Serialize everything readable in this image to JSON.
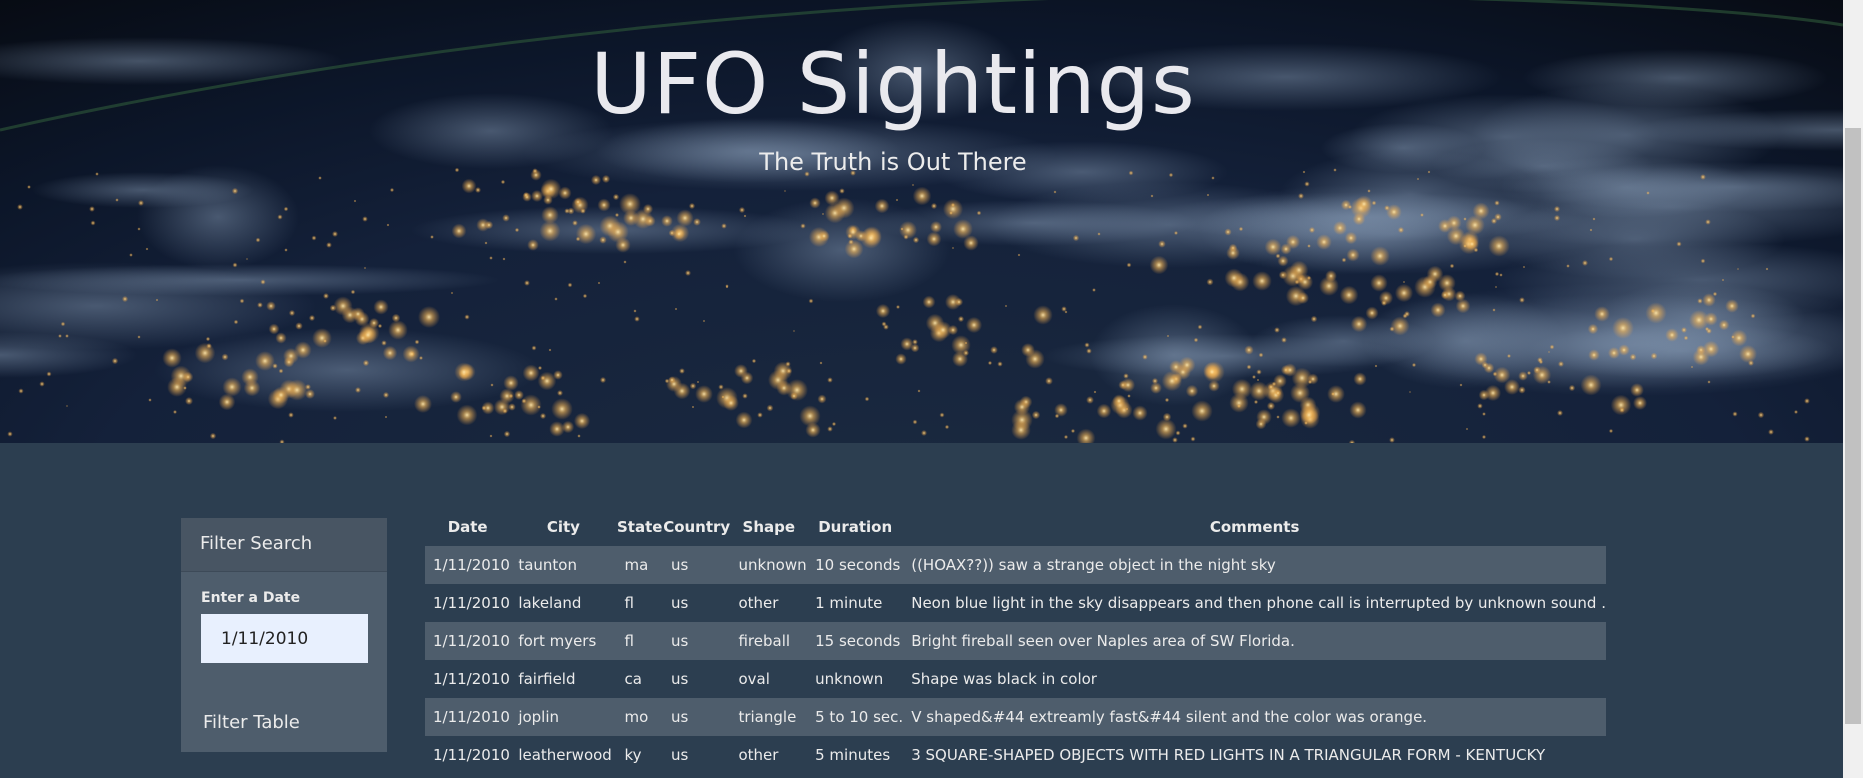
{
  "hero": {
    "title": "UFO Sightings",
    "subtitle": "The Truth is Out There"
  },
  "filter": {
    "header": "Filter Search",
    "date_label": "Enter a Date",
    "date_value": "1/11/2010",
    "button_label": "Filter Table"
  },
  "table": {
    "columns": [
      "Date",
      "City",
      "State",
      "Country",
      "Shape",
      "Duration",
      "Comments"
    ],
    "rows": [
      [
        "1/11/2010",
        "taunton",
        "ma",
        "us",
        "unknown",
        "10 seconds",
        "((HOAX??)) saw a strange object in the night sky"
      ],
      [
        "1/11/2010",
        "lakeland",
        "fl",
        "us",
        "other",
        "1 minute",
        "Neon blue light in the sky disappears and then phone call is interrupted by unknown sound ."
      ],
      [
        "1/11/2010",
        "fort myers",
        "fl",
        "us",
        "fireball",
        "15 seconds",
        "Bright fireball seen over Naples area of SW Florida."
      ],
      [
        "1/11/2010",
        "fairfield",
        "ca",
        "us",
        "oval",
        "unknown",
        "Shape was black in color"
      ],
      [
        "1/11/2010",
        "joplin",
        "mo",
        "us",
        "triangle",
        "5 to 10 sec.",
        "V shaped&#44 extreamly fast&#44 silent and the color was orange."
      ],
      [
        "1/11/2010",
        "leatherwood",
        "ky",
        "us",
        "other",
        "5 minutes",
        "3 SQUARE-SHAPED OBJECTS WITH RED LIGHTS IN A TRIANGULAR FORM - KENTUCKY"
      ]
    ]
  },
  "colors": {
    "background": "#2c3e50",
    "row_alt": "#4e5d6c",
    "input_bg": "#e8f0fe"
  }
}
